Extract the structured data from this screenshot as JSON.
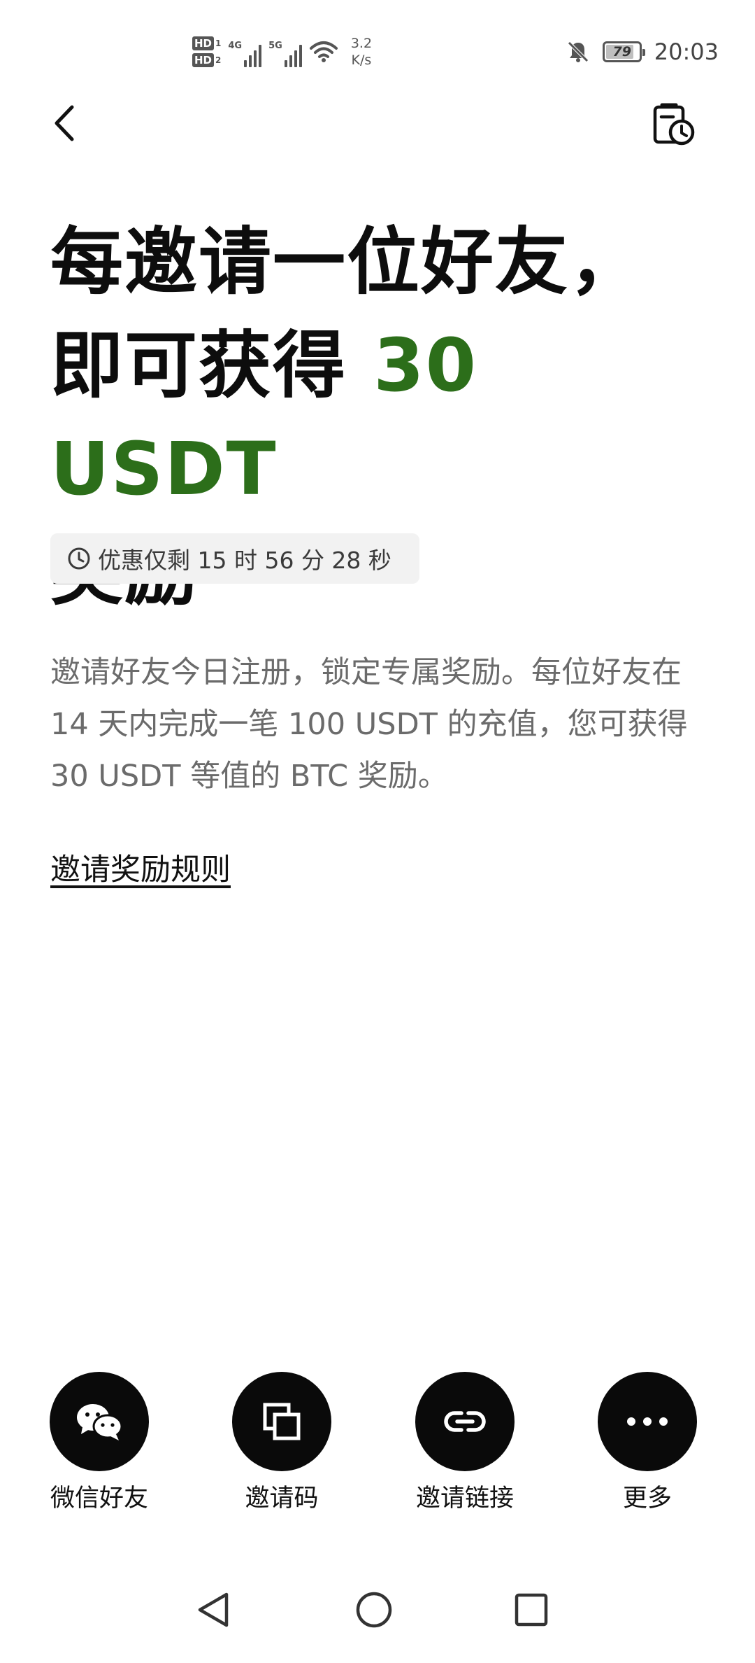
{
  "status_bar": {
    "sim1": "HD",
    "sim1_index": "1",
    "sim2": "HD",
    "sim2_index": "2",
    "net1_type": "4G",
    "net2_type": "5G",
    "speed_value": "3.2",
    "speed_unit": "K/s",
    "battery": "79",
    "battery_level": 0.79,
    "time": "20:03"
  },
  "header": {
    "back_icon": "chevron-left-icon",
    "history_icon": "history-clock-icon"
  },
  "headline": {
    "line1": "每邀请一位好友，",
    "line2_prefix": "即可获得 ",
    "line2_amount": "30 USDT",
    "line3": "奖励",
    "accent_color": "#2c6e1a"
  },
  "timer": {
    "icon": "clock-icon",
    "text": "优惠仅剩 15 时 56 分 28 秒"
  },
  "description": "邀请好友今日注册，锁定专属奖励。每位好友在 14 天内完成一笔 100 USDT 的充值，您可获得 30 USDT 等值的 BTC 奖励。",
  "rules_link": "邀请奖励规则",
  "share": {
    "wechat": {
      "label": "微信好友",
      "icon": "wechat-icon"
    },
    "code": {
      "label": "邀请码",
      "icon": "copy-icon"
    },
    "link": {
      "label": "邀请链接",
      "icon": "link-icon"
    },
    "more": {
      "label": "更多",
      "icon": "more-dots-icon"
    }
  },
  "nav": {
    "back_icon": "nav-back-triangle-icon",
    "home_icon": "nav-home-circle-icon",
    "recents_icon": "nav-recents-square-icon"
  }
}
